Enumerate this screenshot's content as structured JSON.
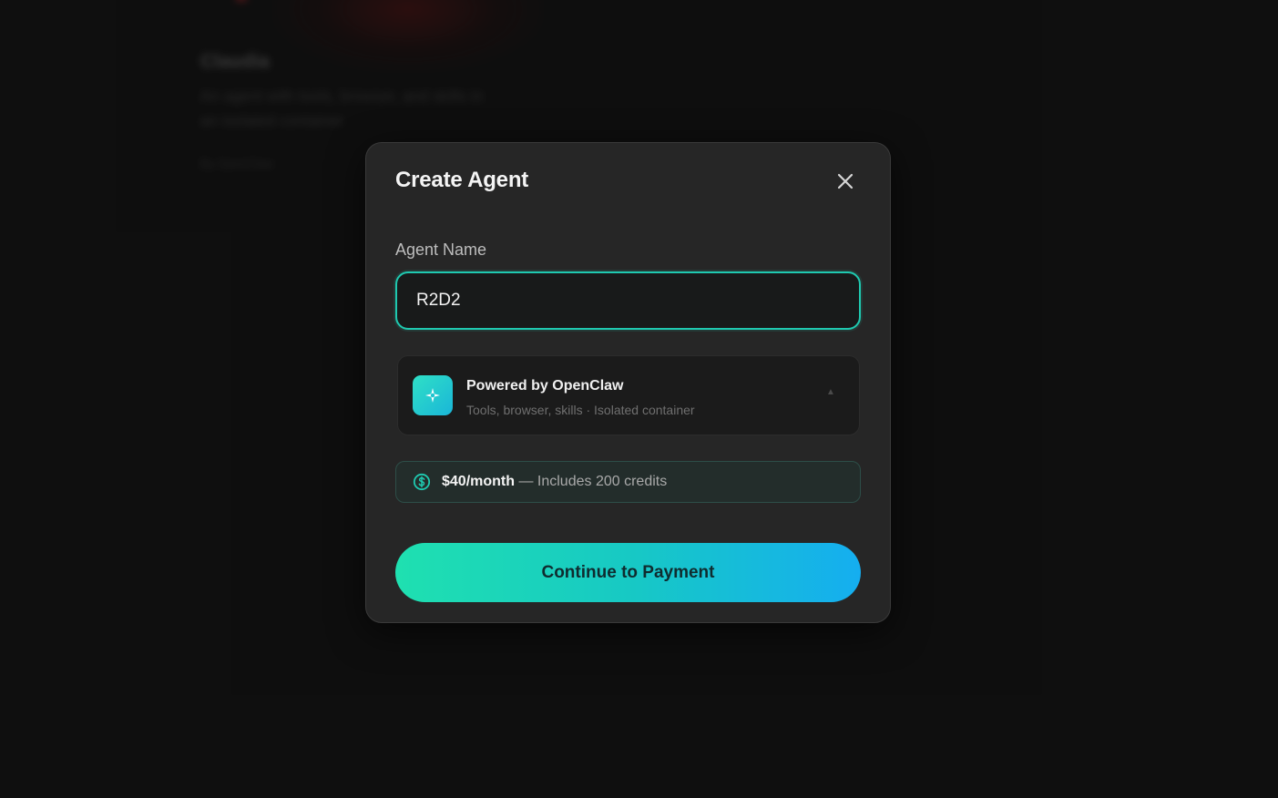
{
  "background_card": {
    "title": "Claudia",
    "description": "An agent with tools, browser, and skills in an isolated container",
    "meta": "By OpenClaw"
  },
  "modal": {
    "title": "Create Agent",
    "close_icon": "close-icon",
    "agent_name_label": "Agent Name",
    "agent_name_value": "R2D2",
    "provider": {
      "icon": "sparkle-icon",
      "name": "Powered by OpenClaw",
      "subtitle": "Tools, browser, skills · Isolated container"
    },
    "pricing": {
      "icon": "dollar-circle-icon",
      "price": "$40/month",
      "details": " — Includes 200 credits"
    },
    "continue_button": "Continue to Payment"
  },
  "colors": {
    "accent": "#1fc9b0",
    "background": "#121212",
    "modal": "#262626"
  }
}
